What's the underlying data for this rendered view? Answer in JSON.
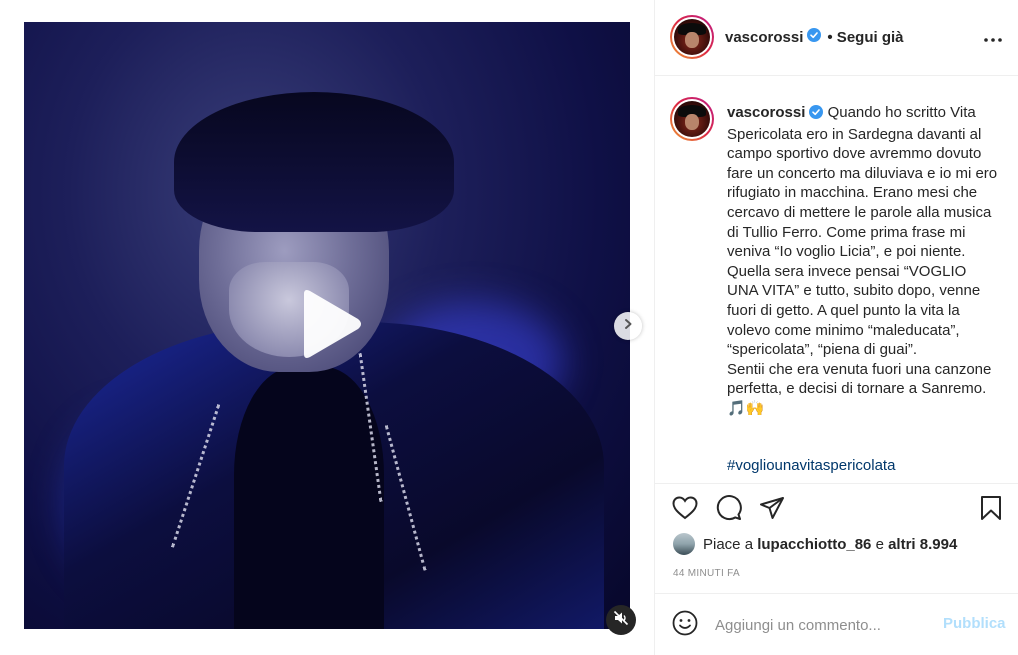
{
  "post": {
    "username": "vascorossi",
    "follow_state": "• Segui già",
    "caption_lines": "Quando ho scritto Vita Spericolata ero in Sardegna davanti al campo sportivo dove avremmo dovuto fare un concerto ma diluviava e io mi ero rifugiato in macchina. Erano mesi che cercavo di mettere le parole alla musica di Tullio Ferro. Come prima frase mi veniva “Io voglio Licia”, e poi niente.\nQuella sera invece pensai “VOGLIO UNA VITA” e tutto, subito dopo, venne fuori di getto. A quel punto la vita la volevo come minimo “maleducata”, “spericolata”, “piena di guai”.\nSentii che era venuta fuori una canzone perfetta, e decisi di tornare a Sanremo. 🎵🙌",
    "hashtag": "#vogliounavitaspericolata",
    "likes_prefix": "Piace a ",
    "liked_by": "lupacchiotto_86",
    "likes_middle": " e ",
    "likes_others": "altri 8.994",
    "time_ago": "44 MINUTI FA"
  },
  "comment": {
    "placeholder": "Aggiungi un commento...",
    "post_label": "Pubblica"
  },
  "icons": {
    "verified": "verified-badge-icon",
    "more": "more-options-icon",
    "like": "heart-icon",
    "comment": "comment-bubble-icon",
    "share": "paper-plane-icon",
    "save": "bookmark-icon",
    "emoji": "smiley-icon",
    "play": "play-icon",
    "mute": "muted-speaker-icon",
    "next": "chevron-right-icon"
  },
  "colors": {
    "verified_blue": "#3897f0",
    "hashtag_link": "#00376b",
    "post_button_disabled": "#b2dffc",
    "muted_text": "#8e8e8e"
  }
}
